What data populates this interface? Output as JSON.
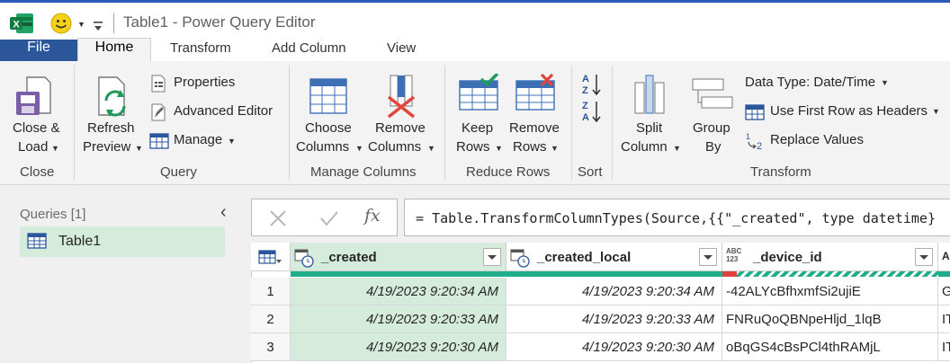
{
  "window": {
    "title": "Table1 - Power Query Editor"
  },
  "tabs": [
    "File",
    "Home",
    "Transform",
    "Add Column",
    "View"
  ],
  "ribbon": {
    "close_group": {
      "label": "Close",
      "close_load": [
        "Close &",
        "Load"
      ]
    },
    "query_group": {
      "label": "Query",
      "refresh": [
        "Refresh",
        "Preview"
      ],
      "properties": "Properties",
      "advanced_editor": "Advanced Editor",
      "manage": "Manage"
    },
    "manage_columns_group": {
      "label": "Manage Columns",
      "choose": [
        "Choose",
        "Columns"
      ],
      "remove": [
        "Remove",
        "Columns"
      ]
    },
    "reduce_rows_group": {
      "label": "Reduce Rows",
      "keep": [
        "Keep",
        "Rows"
      ],
      "remove": [
        "Remove",
        "Rows"
      ]
    },
    "sort_group": {
      "label": "Sort"
    },
    "transform_group": {
      "label": "Transform",
      "split": [
        "Split",
        "Column"
      ],
      "group_by": [
        "Group",
        "By"
      ],
      "data_type": "Data Type: Date/Time",
      "first_row": "Use First Row as Headers",
      "replace": "Replace Values"
    }
  },
  "queries": {
    "label": "Queries [1]",
    "items": [
      "Table1"
    ]
  },
  "formula": "= Table.TransformColumnTypes(Source,{{\"_created\", type datetime}",
  "grid": {
    "columns": [
      {
        "name": "_created",
        "type_badge": "date"
      },
      {
        "name": "_created_local",
        "type_badge": "date"
      },
      {
        "name": "_device_id",
        "type_badge": "ABC 123"
      }
    ],
    "rows": [
      {
        "n": "1",
        "created": "4/19/2023 9:20:34 AM",
        "local": "4/19/2023 9:20:34 AM",
        "device": "-42ALYcBfhxmfSi2ujiE",
        "next": "G"
      },
      {
        "n": "2",
        "created": "4/19/2023 9:20:33 AM",
        "local": "4/19/2023 9:20:33 AM",
        "device": "FNRuQoQBNpeHljd_1lqB",
        "next": "IT"
      },
      {
        "n": "3",
        "created": "4/19/2023 9:20:30 AM",
        "local": "4/19/2023 9:20:30 AM",
        "device": "oBqGS4cBsPCl4thRAMjL",
        "next": "IT"
      }
    ],
    "next_col_partial": "A"
  },
  "colors": {
    "accent": "#2b579a",
    "selected": "#d5ebdc",
    "quality_green": "#1fad8a",
    "quality_error": "#e04040"
  }
}
